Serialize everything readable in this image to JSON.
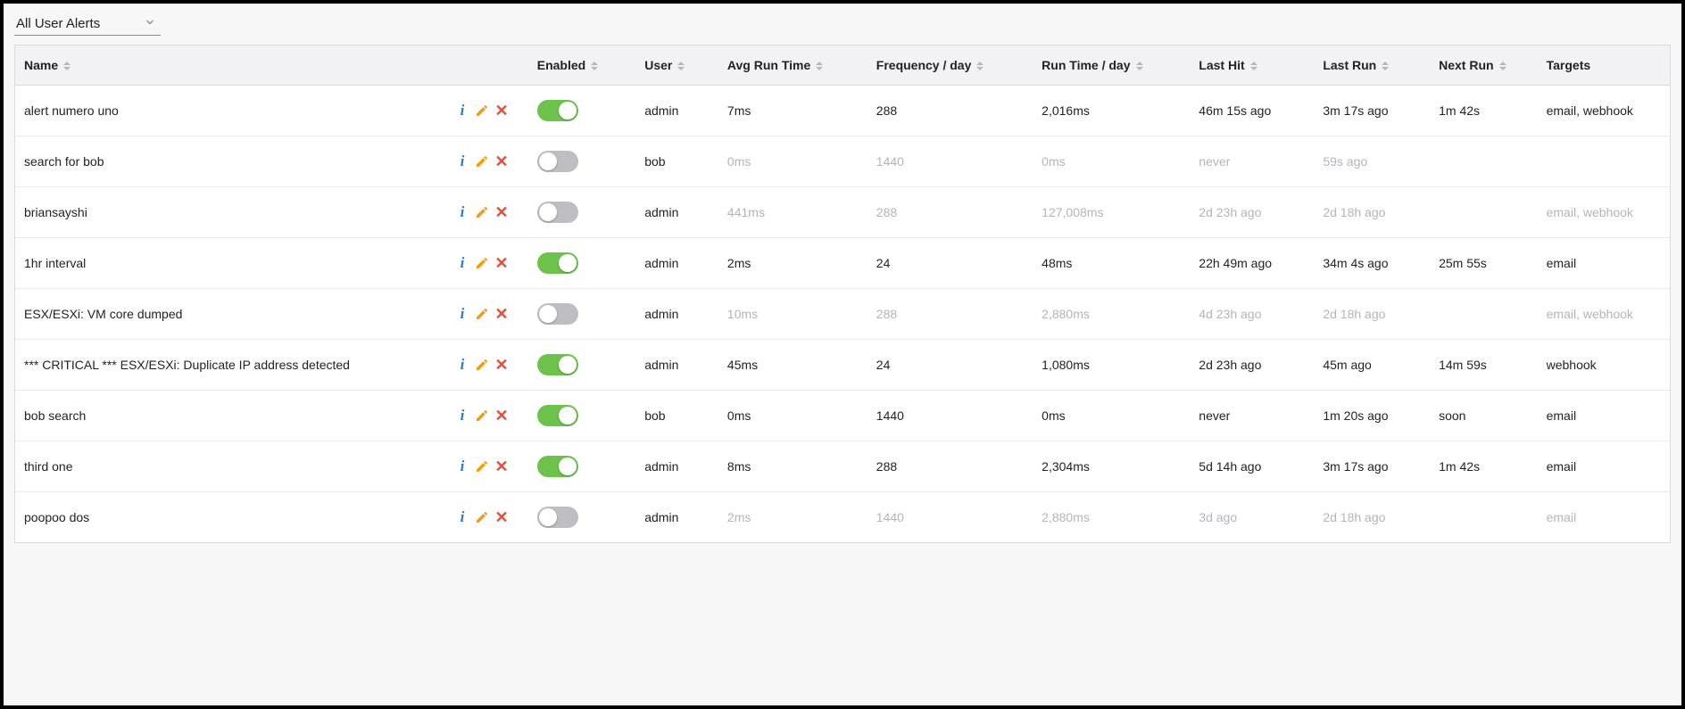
{
  "filter": {
    "label": "All User Alerts"
  },
  "columns": {
    "name": "Name",
    "enabled": "Enabled",
    "user": "User",
    "avg_run_time": "Avg Run Time",
    "frequency": "Frequency / day",
    "run_time_day": "Run Time / day",
    "last_hit": "Last Hit",
    "last_run": "Last Run",
    "next_run": "Next Run",
    "targets": "Targets"
  },
  "rows": [
    {
      "name": "alert numero uno",
      "enabled": true,
      "user": "admin",
      "avg": "7ms",
      "freq": "288",
      "rtday": "2,016ms",
      "last_hit": "46m 15s ago",
      "last_run": "3m 17s ago",
      "next_run": "1m 42s",
      "targets": "email, webhook"
    },
    {
      "name": "search for bob",
      "enabled": false,
      "user": "bob",
      "avg": "0ms",
      "freq": "1440",
      "rtday": "0ms",
      "last_hit": "never",
      "last_run": "59s ago",
      "next_run": "",
      "targets": ""
    },
    {
      "name": "briansayshi",
      "enabled": false,
      "user": "admin",
      "avg": "441ms",
      "freq": "288",
      "rtday": "127,008ms",
      "last_hit": "2d 23h ago",
      "last_run": "2d 18h ago",
      "next_run": "",
      "targets": "email, webhook"
    },
    {
      "name": "1hr interval",
      "enabled": true,
      "user": "admin",
      "avg": "2ms",
      "freq": "24",
      "rtday": "48ms",
      "last_hit": "22h 49m ago",
      "last_run": "34m 4s ago",
      "next_run": "25m 55s",
      "targets": "email"
    },
    {
      "name": "ESX/ESXi: VM core dumped",
      "enabled": false,
      "user": "admin",
      "avg": "10ms",
      "freq": "288",
      "rtday": "2,880ms",
      "last_hit": "4d 23h ago",
      "last_run": "2d 18h ago",
      "next_run": "",
      "targets": "email, webhook"
    },
    {
      "name": "*** CRITICAL *** ESX/ESXi: Duplicate IP address detected",
      "enabled": true,
      "user": "admin",
      "avg": "45ms",
      "freq": "24",
      "rtday": "1,080ms",
      "last_hit": "2d 23h ago",
      "last_run": "45m ago",
      "next_run": "14m 59s",
      "targets": "webhook"
    },
    {
      "name": "bob search",
      "enabled": true,
      "user": "bob",
      "avg": "0ms",
      "freq": "1440",
      "rtday": "0ms",
      "last_hit": "never",
      "last_run": "1m 20s ago",
      "next_run": "soon",
      "targets": "email"
    },
    {
      "name": "third one",
      "enabled": true,
      "user": "admin",
      "avg": "8ms",
      "freq": "288",
      "rtday": "2,304ms",
      "last_hit": "5d 14h ago",
      "last_run": "3m 17s ago",
      "next_run": "1m 42s",
      "targets": "email"
    },
    {
      "name": "poopoo dos",
      "enabled": false,
      "user": "admin",
      "avg": "2ms",
      "freq": "1440",
      "rtday": "2,880ms",
      "last_hit": "3d ago",
      "last_run": "2d 18h ago",
      "next_run": "",
      "targets": "email"
    }
  ]
}
